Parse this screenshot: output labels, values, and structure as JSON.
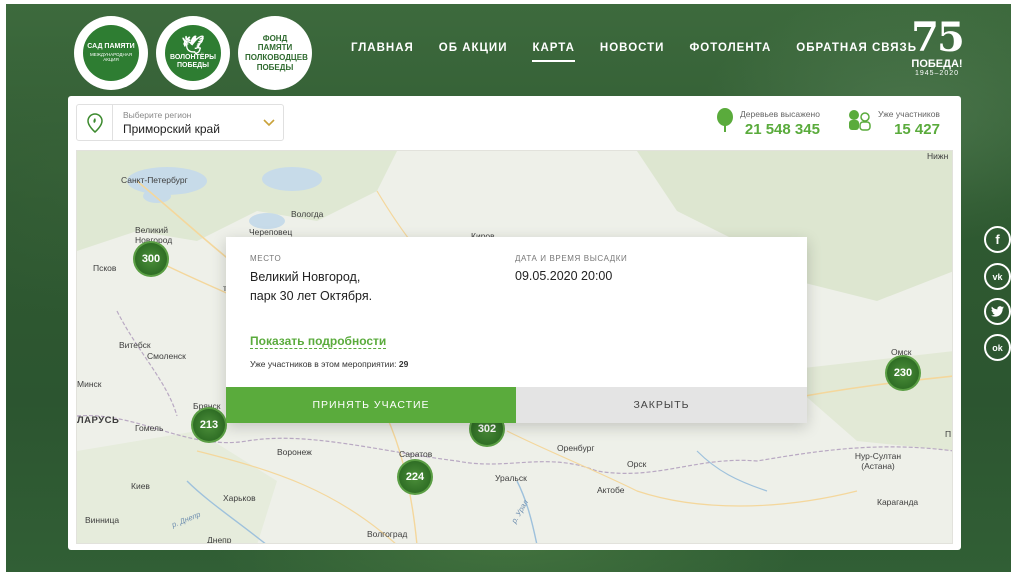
{
  "logos": {
    "garden": "САД ПАМЯТИ",
    "garden_sub": "МЕЖДУНАРОДНАЯ АКЦИЯ",
    "volunteers": "ВОЛОНТЁРЫ ПОБЕДЫ",
    "fund": "ФОНД ПАМЯТИ ПОЛКОВОДЦЕВ ПОБЕДЫ"
  },
  "nav": {
    "items": [
      {
        "label": "ГЛАВНАЯ"
      },
      {
        "label": "ОБ АКЦИИ"
      },
      {
        "label": "КАРТА"
      },
      {
        "label": "НОВОСТИ"
      },
      {
        "label": "ФОТОЛЕНТА"
      },
      {
        "label": "ОБРАТНАЯ СВЯЗЬ"
      }
    ],
    "active": "КАРТА"
  },
  "victory": {
    "number": "75",
    "word": "ПОБЕДА!",
    "years": "1945–2020"
  },
  "region": {
    "label": "Выберите регион",
    "value": "Приморский край"
  },
  "stats": {
    "trees_label": "Деревьев высажено",
    "trees_value": "21 548 345",
    "participants_label": "Уже участников",
    "participants_value": "15 427"
  },
  "map": {
    "cities": [
      "Санкт-Петербург",
      "Вологда",
      "Череповец",
      "Великий Новгород",
      "Псков",
      "Киров",
      "Витебск",
      "Смоленск",
      "Минск",
      "ЛАРУСЬ",
      "Гомель",
      "Брянск",
      "Воронеж",
      "Саратов",
      "Оренбург",
      "Орск",
      "Уральск",
      "Актобе",
      "Киев",
      "Харьков",
      "Винница",
      "Днепр",
      "Волгоград",
      "Омск",
      "Нур-Султан (Астана)",
      "Караганда",
      "Нижн"
    ],
    "rivers": [
      "р. Днепр",
      "р. Урал"
    ],
    "clusters": [
      {
        "count": "300"
      },
      {
        "count": "213"
      },
      {
        "count": "224"
      },
      {
        "count": "302"
      },
      {
        "count": "230"
      }
    ],
    "edge_letters": [
      "т",
      "П"
    ]
  },
  "popup": {
    "place_label": "МЕСТО",
    "place_value_line1": "Великий Новгород,",
    "place_value_line2": "парк 30 лет Октября.",
    "date_label": "ДАТА И ВРЕМЯ ВЫСАДКИ",
    "date_value": "09.05.2020 20:00",
    "details_link": "Показать подробности",
    "participants_text": "Уже участников в этом мероприятии:",
    "participants_count": "29",
    "join_button": "ПРИНЯТЬ УЧАСТИЕ",
    "close_button": "ЗАКРЫТЬ"
  },
  "social": [
    {
      "icon": "facebook-icon",
      "glyph": "f"
    },
    {
      "icon": "vk-icon",
      "glyph": "vk"
    },
    {
      "icon": "twitter-icon",
      "glyph": "🐦"
    },
    {
      "icon": "odnoklassniki-icon",
      "glyph": "ok"
    }
  ],
  "colors": {
    "accent": "#5aab3c",
    "header_bg": "#2f5a31",
    "cluster": "#3c7f2e"
  }
}
